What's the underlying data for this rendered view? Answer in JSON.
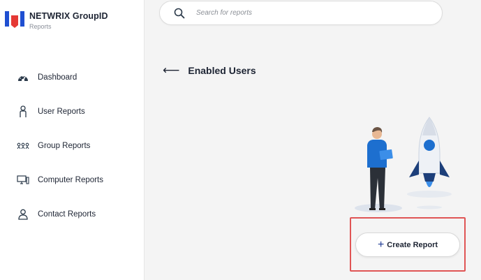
{
  "brand": {
    "title": "NETWRIX GroupID",
    "subtitle": "Reports"
  },
  "search": {
    "placeholder": "Search for reports"
  },
  "nav": {
    "items": [
      {
        "label": "Dashboard",
        "icon": "dashboard-gauge-icon"
      },
      {
        "label": "User Reports",
        "icon": "user-icon"
      },
      {
        "label": "Group Reports",
        "icon": "group-icon"
      },
      {
        "label": "Computer Reports",
        "icon": "computer-icon"
      },
      {
        "label": "Contact Reports",
        "icon": "contact-icon"
      }
    ]
  },
  "header": {
    "back_icon": "back-arrow-icon",
    "title": "Enabled Users"
  },
  "actions": {
    "create_label": "Create Report",
    "create_icon": "plus-icon"
  },
  "colors": {
    "sidebar_bg": "#ffffff",
    "content_bg": "#f4f4f4",
    "brand_blue": "#1f4fd1",
    "brand_red": "#e53935",
    "highlight": "#e05555"
  }
}
